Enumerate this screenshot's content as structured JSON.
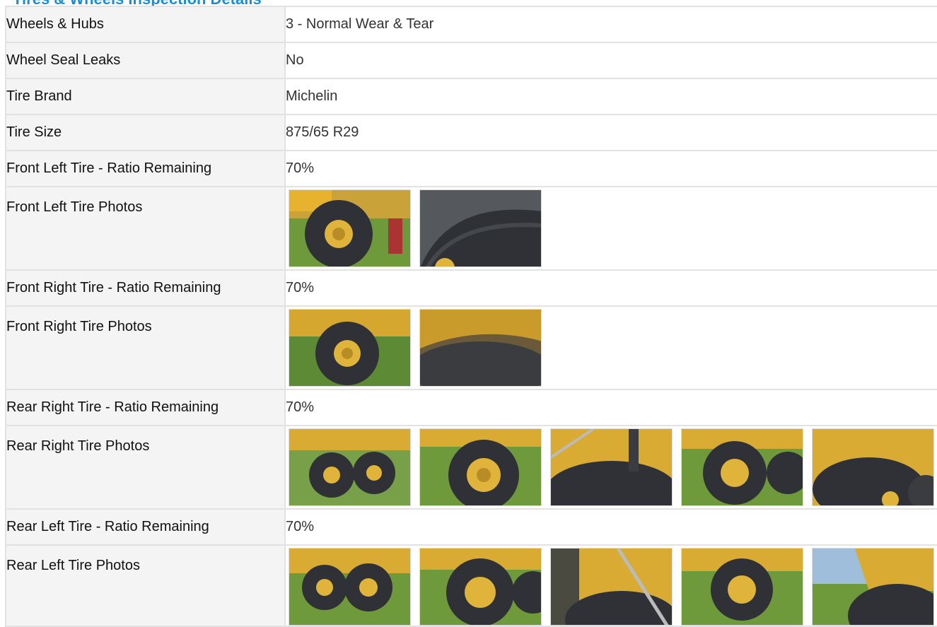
{
  "header": {
    "title_fragment": "Tires & Wheels Inspection Details"
  },
  "rows": [
    {
      "label": "Wheels & Hubs",
      "value": "3 - Normal Wear & Tear"
    },
    {
      "label": "Wheel Seal Leaks",
      "value": "No"
    },
    {
      "label": "Tire Brand",
      "value": "Michelin"
    },
    {
      "label": "Tire Size",
      "value": "875/65 R29"
    },
    {
      "label": "Front Left Tire - Ratio Remaining",
      "value": "70%"
    },
    {
      "label": "Front Left Tire Photos",
      "photo_count": 2
    },
    {
      "label": "Front Right Tire - Ratio Remaining",
      "value": "70%"
    },
    {
      "label": "Front Right Tire Photos",
      "photo_count": 2
    },
    {
      "label": "Rear Right Tire - Ratio Remaining",
      "value": "70%"
    },
    {
      "label": "Rear Right Tire Photos",
      "photo_count": 5
    },
    {
      "label": "Rear Left Tire - Ratio Remaining",
      "value": "70%"
    },
    {
      "label": "Rear Left Tire Photos",
      "photo_count": 5
    }
  ],
  "colors": {
    "label_bg": "#f4f4f4",
    "border": "#e2e2e2",
    "link": "#1a8fd1",
    "machine_yellow": "#e7b32e",
    "tire": "#2f3136",
    "grass": "#6f9a3c"
  }
}
